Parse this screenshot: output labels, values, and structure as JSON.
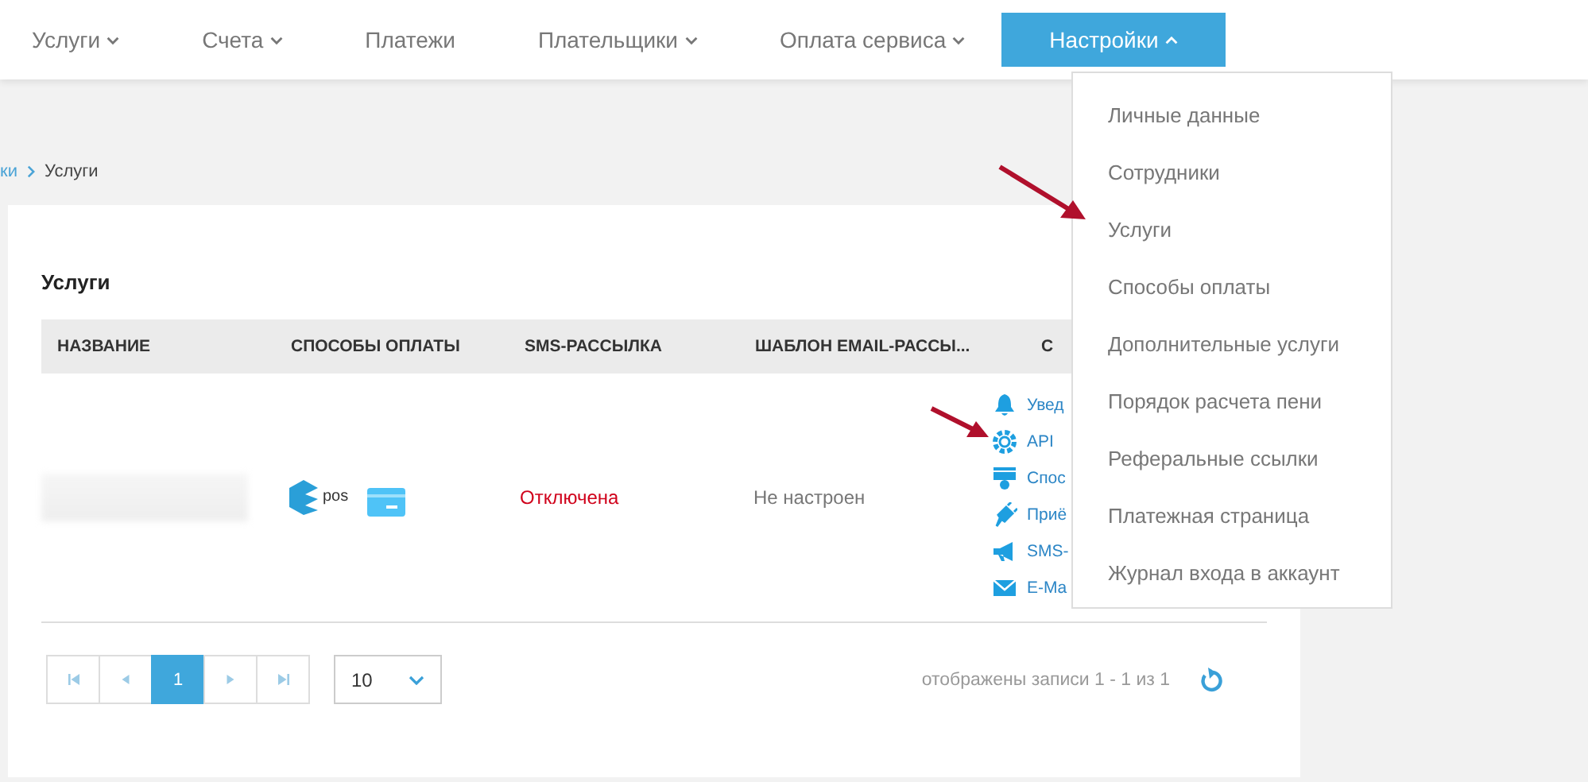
{
  "nav": [
    {
      "label": "Услуги",
      "has_menu": true,
      "selected": false
    },
    {
      "label": "Счета",
      "has_menu": true,
      "selected": false
    },
    {
      "label": "Платежи",
      "has_menu": false,
      "selected": false
    },
    {
      "label": "Плательщики",
      "has_menu": true,
      "selected": false
    },
    {
      "label": "Оплата сервиса",
      "has_menu": true,
      "selected": false
    },
    {
      "label": "Настройки",
      "has_menu": true,
      "selected": true
    }
  ],
  "settings_menu": [
    "Личные данные",
    "Сотрудники",
    "Услуги",
    "Способы оплаты",
    "Дополнительные услуги",
    "Порядок расчета пени",
    "Реферальные ссылки",
    "Платежная страница",
    "Журнал входа в аккаунт"
  ],
  "breadcrumb": [
    {
      "label": "ки",
      "link": true
    },
    {
      "label": "Услуги",
      "link": false
    }
  ],
  "card": {
    "title": "Услуги",
    "columns": [
      "НАЗВАНИЕ",
      "СПОСОБЫ ОПЛАТЫ",
      "SMS-РАССЫЛКА",
      "ШАБЛОН EMAIL-РАССЫ...",
      "С"
    ],
    "rows": [
      {
        "payment_logo": "pos",
        "sms": "Отключена",
        "email_template": "Не настроен",
        "actions": [
          {
            "kind": "bell",
            "label": "Увед"
          },
          {
            "kind": "gear",
            "label": "API"
          },
          {
            "kind": "terminal",
            "label": "Спос"
          },
          {
            "kind": "plug",
            "label": "Приё"
          },
          {
            "kind": "megaphone",
            "label": "SMS-"
          },
          {
            "kind": "mail",
            "label": "E-Ma"
          }
        ]
      }
    ]
  },
  "pagination": {
    "pages": [
      {
        "label": "1",
        "selected": true
      }
    ],
    "page_size": "10",
    "info": "отображены записи 1 - 1 из 1"
  }
}
